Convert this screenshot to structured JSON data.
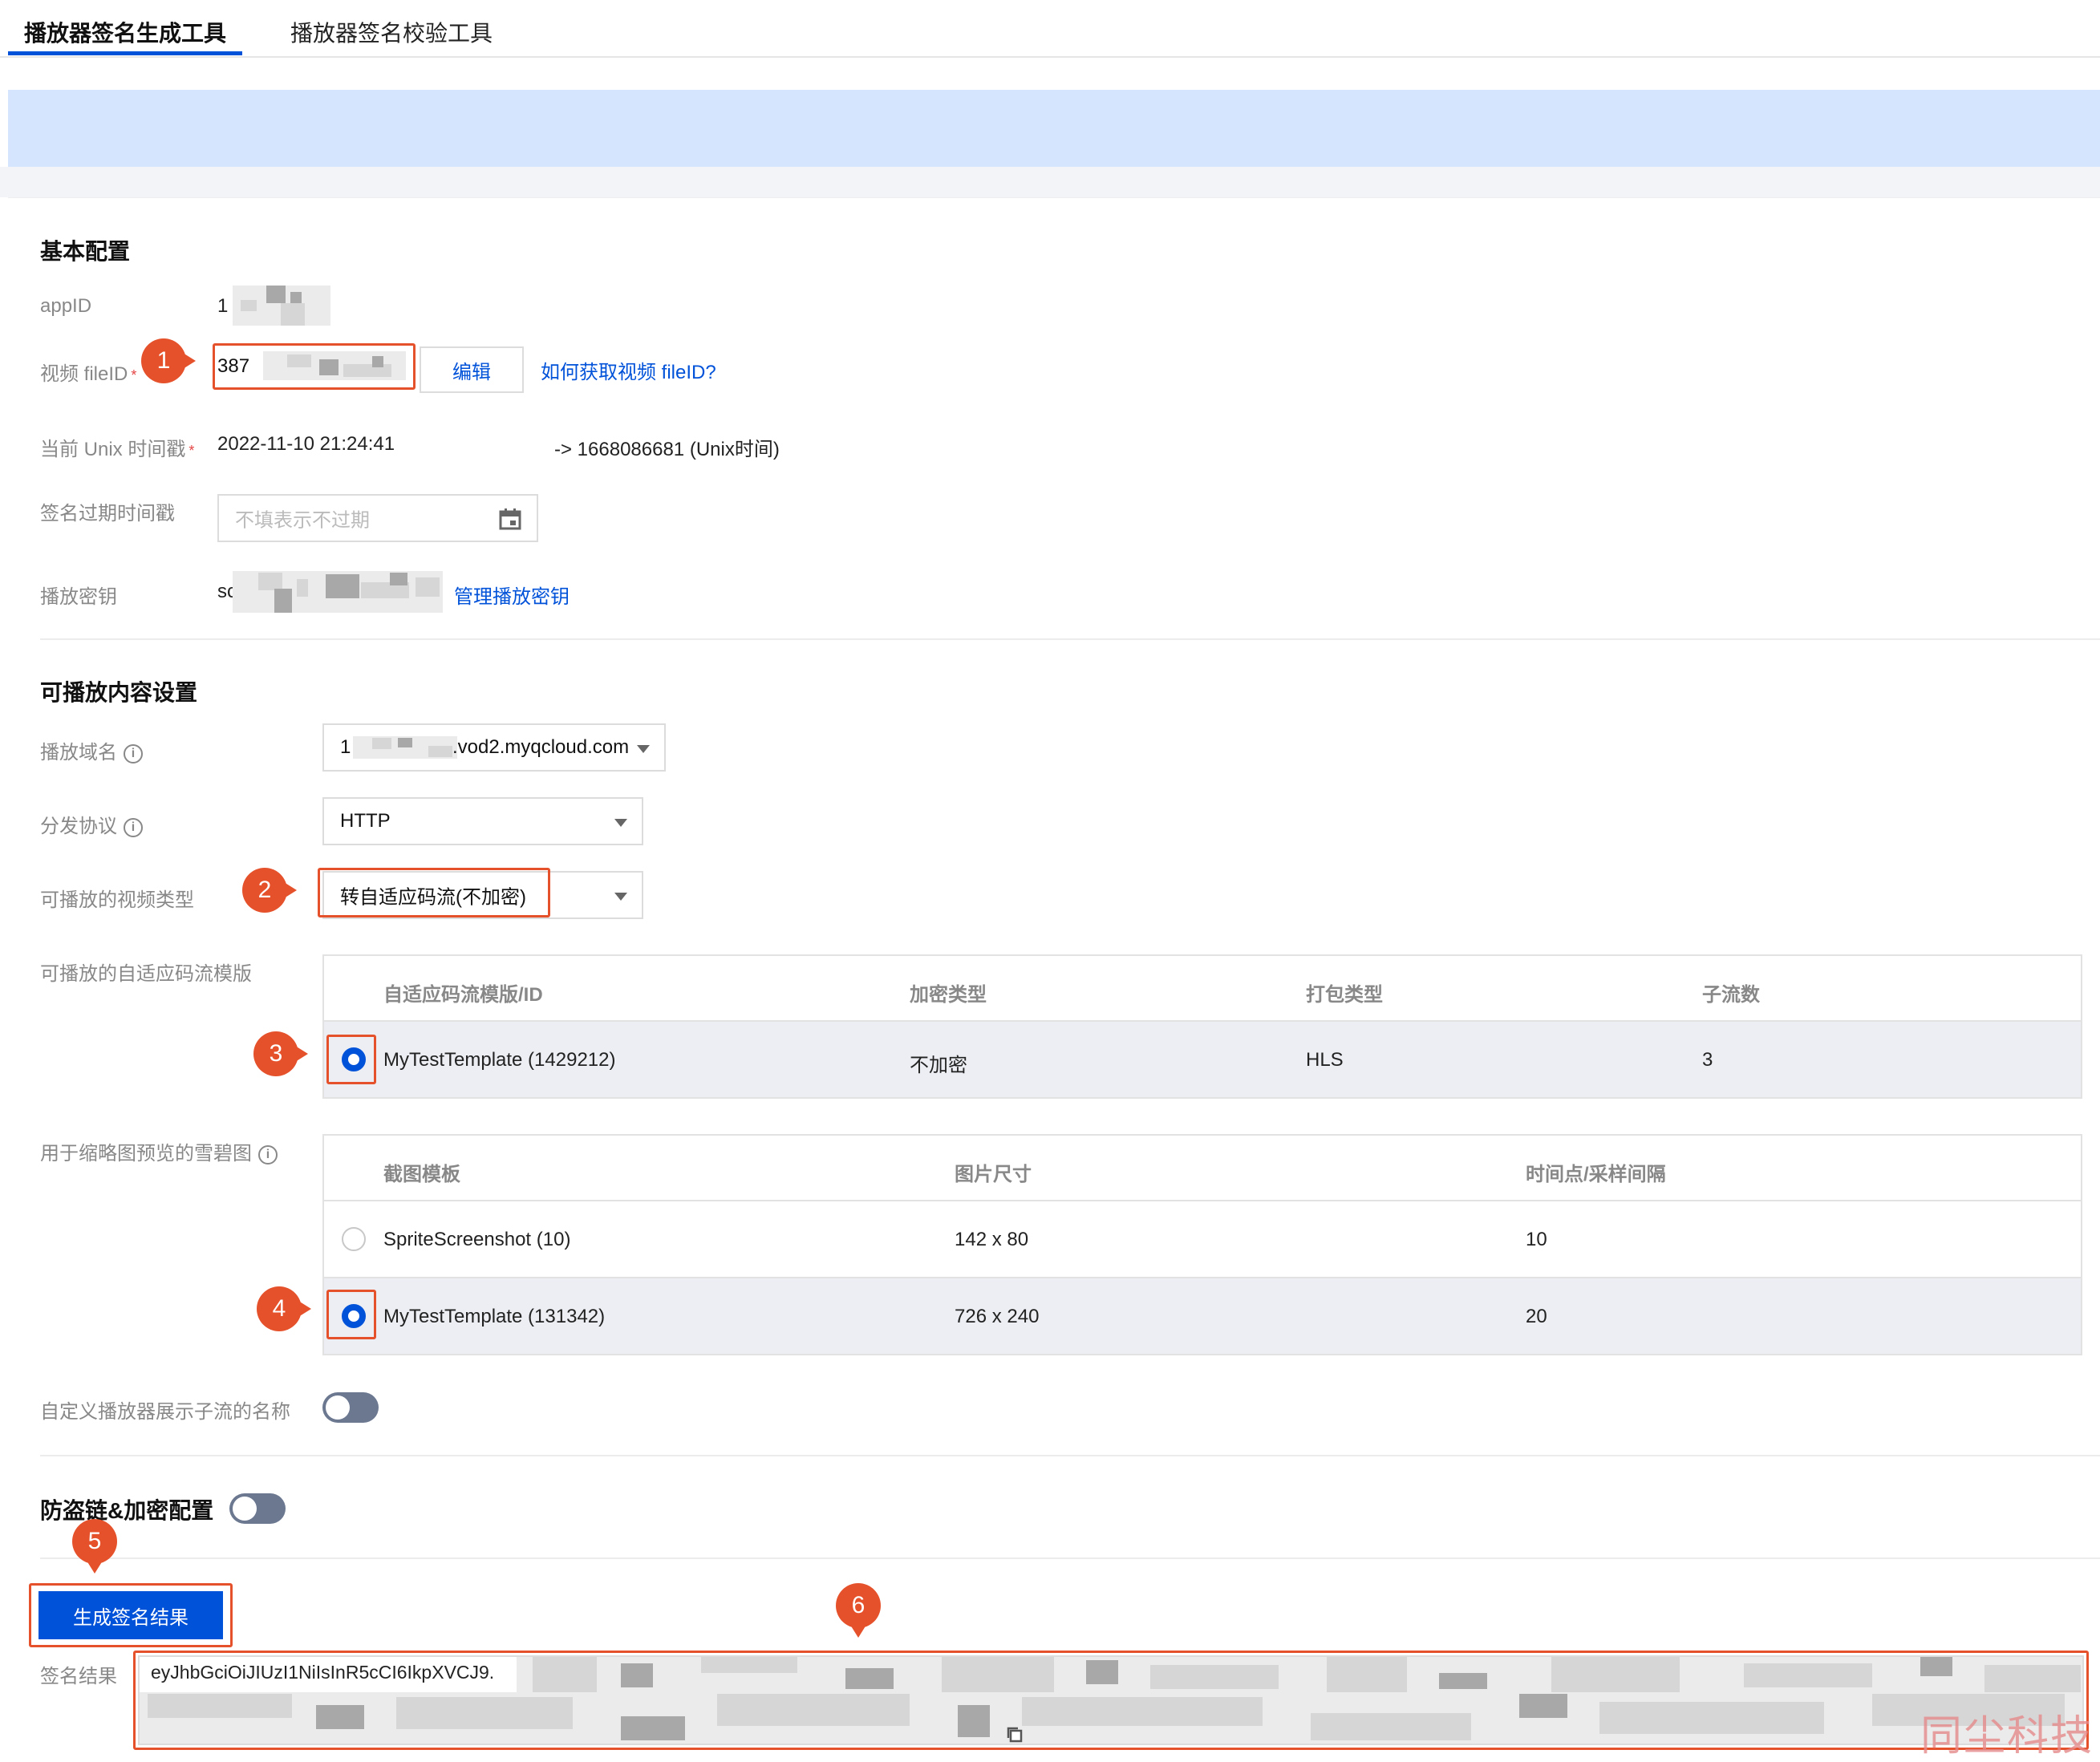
{
  "tabs": [
    {
      "label": "播放器签名生成工具"
    },
    {
      "label": "播放器签名校验工具"
    }
  ],
  "basic": {
    "title": "基本配置",
    "appid_label": "appID",
    "appid_value": "1",
    "fileid_label": "视频 fileID",
    "fileid_value": "387",
    "edit_button": "编辑",
    "fileid_help": "如何获取视频 fileID?",
    "unix_label": "当前 Unix 时间戳",
    "unix_datetime": "2022-11-10 21:24:41",
    "unix_converted": "-> 1668086681 (Unix时间)",
    "expire_label": "签名过期时间戳",
    "expire_placeholder": "不填表示不过期",
    "key_label": "播放密钥",
    "key_value": "sc",
    "key_manage": "管理播放密钥"
  },
  "content": {
    "title": "可播放内容设置",
    "domain_label": "播放域名",
    "domain_value_prefix": "1",
    "domain_value_suffix": ".vod2.myqcloud.com",
    "protocol_label": "分发协议",
    "protocol_value": "HTTP",
    "video_type_label": "可播放的视频类型",
    "video_type_value": "转自适应码流(不加密)",
    "adaptive_label": "可播放的自适应码流模版",
    "adaptive_headers": [
      "自适应码流模版/ID",
      "加密类型",
      "打包类型",
      "子流数"
    ],
    "adaptive_rows": [
      {
        "name": "MyTestTemplate (1429212)",
        "encrypt": "不加密",
        "package": "HLS",
        "streams": "3",
        "selected": true
      }
    ],
    "sprite_label": "用于缩略图预览的雪碧图",
    "sprite_headers": [
      "截图模板",
      "图片尺寸",
      "时间点/采样间隔"
    ],
    "sprite_rows": [
      {
        "name": "SpriteScreenshot (10)",
        "size": "142 x 80",
        "interval": "10",
        "selected": false
      },
      {
        "name": "MyTestTemplate (131342)",
        "size": "726 x 240",
        "interval": "20",
        "selected": true
      }
    ],
    "custom_name_label": "自定义播放器展示子流的名称",
    "custom_name_on": false
  },
  "security": {
    "title": "防盗链&加密配置",
    "enabled": false
  },
  "result": {
    "generate_button": "生成签名结果",
    "label": "签名结果",
    "value_prefix": "eyJhbGciOiJIUzI1NiIsInR5cCI6IkpXVCJ9."
  },
  "markers": [
    "1",
    "2",
    "3",
    "4",
    "5",
    "6"
  ],
  "watermark": "同尘科技",
  "colors": {
    "accent": "#0052d9",
    "marker": "#e5512b",
    "notice_bg": "#d5e5fd",
    "required": "#e54545"
  }
}
